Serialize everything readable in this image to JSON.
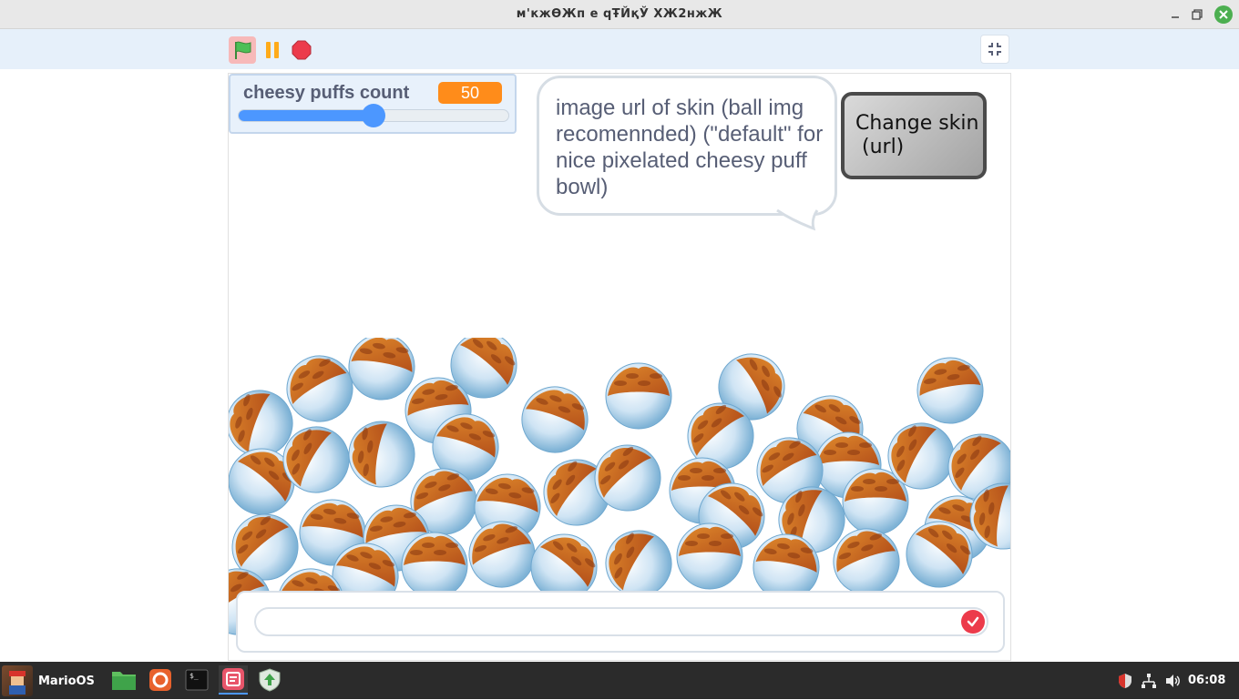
{
  "window": {
    "title": "м'кжѲЖп е qŦЙқЎ ХЖ2нжЖ"
  },
  "toolbar": {
    "green_flag": "green-flag",
    "pause": "pause",
    "stop": "stop",
    "fullscreen": "exit-fullscreen"
  },
  "stage": {
    "monitor": {
      "label": "cheesy puffs count",
      "value": "50",
      "slider_fraction": 0.5
    },
    "speech_bubble": {
      "text": "image url of skin (ball img recomennded) (\"default\" for nice pixelated cheesy puff bowl)"
    },
    "change_skin_button": {
      "line1": "Change skin",
      "line2": " (url)"
    },
    "ask_prompt": {
      "value": ""
    }
  },
  "taskbar": {
    "start_label": "MarioOS",
    "apps": [
      "files-icon",
      "firefox-icon",
      "terminal-icon",
      "scratch-app-icon",
      "update-manager-icon"
    ],
    "tray": [
      "shield-icon",
      "network-icon",
      "volume-icon"
    ],
    "clock": "06:08"
  },
  "colors": {
    "accent": "#4c97ff",
    "monitor_value": "#ff8c1a",
    "stop": "#ec3b4b",
    "flag": "#4cbf56"
  }
}
